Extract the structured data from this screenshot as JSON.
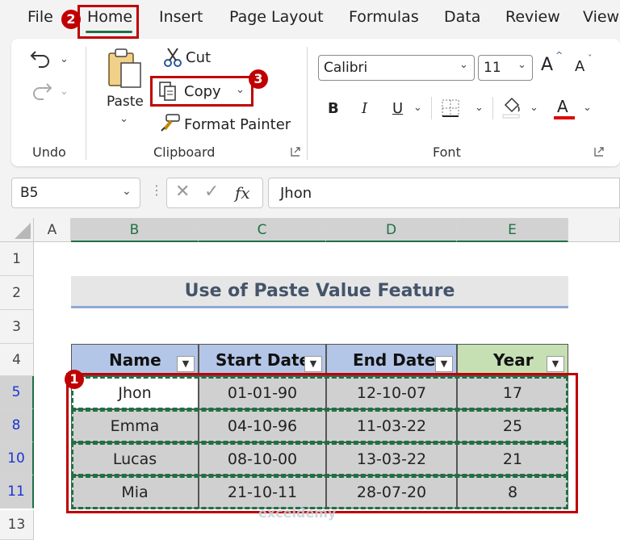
{
  "menu": {
    "tabs": [
      "File",
      "Home",
      "Insert",
      "Page Layout",
      "Formulas",
      "Data",
      "Review",
      "View"
    ]
  },
  "ribbon": {
    "undo_group_label": "Undo",
    "clipboard": {
      "group_label": "Clipboard",
      "paste_label": "Paste",
      "cut_label": "Cut",
      "copy_label": "Copy",
      "format_painter_label": "Format Painter"
    },
    "font": {
      "group_label": "Font",
      "font_name": "Calibri",
      "font_size": "11",
      "bold": "B",
      "italic": "I",
      "underline": "U",
      "grow": "A",
      "shrink": "A",
      "font_color": "A"
    }
  },
  "formula_bar": {
    "name_box": "B5",
    "fx": "fx",
    "content": "Jhon"
  },
  "sheet": {
    "columns": [
      "A",
      "B",
      "C",
      "D",
      "E"
    ],
    "rows": [
      "1",
      "2",
      "3",
      "4",
      "5",
      "8",
      "10",
      "11",
      "13"
    ],
    "title": "Use of Paste Value Feature",
    "headers": [
      "Name",
      "Start Date",
      "End Date",
      "Year"
    ],
    "data": [
      [
        "Jhon",
        "01-01-90",
        "12-10-07",
        "17"
      ],
      [
        "Emma",
        "04-10-96",
        "11-03-22",
        "25"
      ],
      [
        "Lucas",
        "08-10-00",
        "13-03-22",
        "21"
      ],
      [
        "Mia",
        "21-10-11",
        "28-07-20",
        "8"
      ]
    ]
  },
  "callouts": {
    "step1": "1",
    "step2": "2",
    "step3": "3"
  },
  "watermark": "exceldemy",
  "colors": {
    "accent": "#1e7145",
    "callout": "#c00000",
    "header_blue": "#b4c6e7",
    "header_green": "#c6e0b4"
  }
}
